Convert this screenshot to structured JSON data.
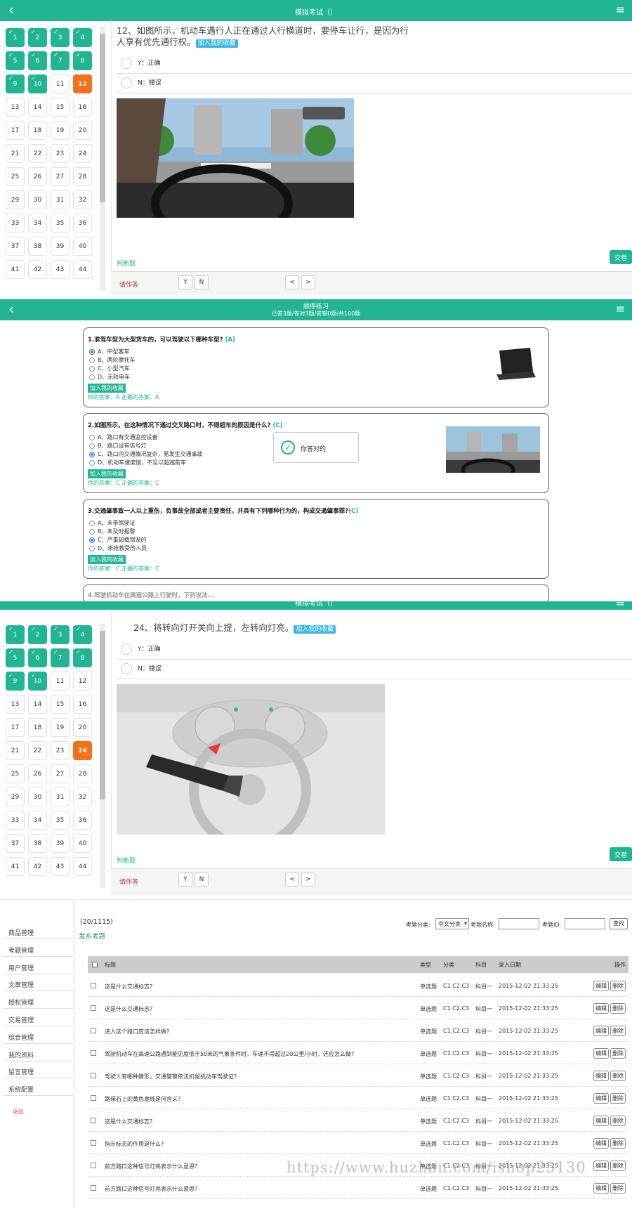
{
  "exam1": {
    "title": "模拟考试（）",
    "cells": [
      {
        "n": "1",
        "s": "ok"
      },
      {
        "n": "2",
        "s": "ok"
      },
      {
        "n": "3",
        "s": "ok"
      },
      {
        "n": "4",
        "s": "ok"
      },
      {
        "n": "5",
        "s": "ok"
      },
      {
        "n": "6",
        "s": "ok"
      },
      {
        "n": "7",
        "s": "ok"
      },
      {
        "n": "8",
        "s": "ok"
      },
      {
        "n": "9",
        "s": "ok"
      },
      {
        "n": "10",
        "s": "ok"
      },
      {
        "n": "11",
        "s": ""
      },
      {
        "n": "12",
        "s": "cur"
      },
      {
        "n": "13",
        "s": ""
      },
      {
        "n": "14",
        "s": ""
      },
      {
        "n": "15",
        "s": ""
      },
      {
        "n": "16",
        "s": ""
      },
      {
        "n": "17",
        "s": ""
      },
      {
        "n": "18",
        "s": ""
      },
      {
        "n": "19",
        "s": ""
      },
      {
        "n": "20",
        "s": ""
      },
      {
        "n": "21",
        "s": ""
      },
      {
        "n": "22",
        "s": ""
      },
      {
        "n": "23",
        "s": ""
      },
      {
        "n": "24",
        "s": ""
      },
      {
        "n": "25",
        "s": ""
      },
      {
        "n": "26",
        "s": ""
      },
      {
        "n": "27",
        "s": ""
      },
      {
        "n": "28",
        "s": ""
      },
      {
        "n": "29",
        "s": ""
      },
      {
        "n": "30",
        "s": ""
      },
      {
        "n": "31",
        "s": ""
      },
      {
        "n": "32",
        "s": ""
      },
      {
        "n": "33",
        "s": ""
      },
      {
        "n": "34",
        "s": ""
      },
      {
        "n": "35",
        "s": ""
      },
      {
        "n": "36",
        "s": ""
      },
      {
        "n": "37",
        "s": ""
      },
      {
        "n": "38",
        "s": ""
      },
      {
        "n": "39",
        "s": ""
      },
      {
        "n": "40",
        "s": ""
      },
      {
        "n": "41",
        "s": ""
      },
      {
        "n": "42",
        "s": ""
      },
      {
        "n": "43",
        "s": ""
      },
      {
        "n": "44",
        "s": ""
      }
    ],
    "question_line1": "12、如图所示，机动车遇行人正在通过人行横道时，要停车让行，是因为行",
    "question_line2": "人享有优先通行权。",
    "fav": "加入我的收藏",
    "opt_y": "Y：正确",
    "opt_n": "N：错误",
    "type_label": "判断题",
    "submit": "交卷",
    "status": "请作答",
    "btn_y": "Y",
    "btn_n": "N",
    "prev": "<",
    "next": ">"
  },
  "practice": {
    "title": "顺序练习",
    "subtitle": "已答3题/答对3题/答错0题/共100题",
    "cards": [
      {
        "q": "1.准驾车型为大型货车的，可以驾驶以下哪种车型?",
        "ans": "(A)",
        "opts": [
          "A、中型客车",
          "B、两轮摩托车",
          "C、小型汽车",
          "D、无轨电车"
        ],
        "sel": 0,
        "fav": "加入我的收藏",
        "res": "你的答案：A   正确的答案：A"
      },
      {
        "q": "2.如图所示，在这种情况下通过交叉路口时，不得超车的原因是什么?",
        "ans": "(C)",
        "opts": [
          "A、路口有交通监控设备",
          "B、路口设有信号灯",
          "C、路口内交通情况复杂，易发生交通事故",
          "D、机动车速度慢，不足以超越前车"
        ],
        "sel": 2,
        "fav": "加入我的收藏",
        "res": "你的答案：C   正确的答案：C"
      },
      {
        "q": "3.交通肇事致一人以上重伤，负事故全部或者主要责任，并具有下列哪种行为的，构成交通肇事罪?",
        "ans": "(C)",
        "opts": [
          "A、未带驾驶证",
          "B、未及时报警",
          "C、严重超载驾驶的",
          "D、未抢救受伤人员"
        ],
        "sel": 2,
        "fav": "加入我的收藏",
        "res": "你的答案：C   正确的答案：C"
      }
    ],
    "toast": "你答对的",
    "partial_q4": "4.驾驶机动车在高速公路上行驶时，下列说法..."
  },
  "exam2": {
    "title": "模拟考试（）",
    "question": "24、将转向灯开关向上提，左转向灯亮。",
    "fav": "加入我的收藏",
    "opt_y": "Y：正确",
    "opt_n": "N：错误",
    "type_label": "判断题",
    "submit": "交卷",
    "status": "请作答",
    "btn_y": "Y",
    "btn_n": "N",
    "prev": "<",
    "next": ">"
  },
  "admin": {
    "menu": [
      "商品管理",
      "考题管理",
      "用户管理",
      "文章管理",
      "授权管理",
      "交易管理",
      "综合管理",
      "我的资料",
      "留言管理",
      "系统配置"
    ],
    "logout": "退出",
    "count": "(20/1115)",
    "publish": "发布考题",
    "filter_label1": "考题分类:",
    "filter_select": "中文分类",
    "filter_label2": "考题名称:",
    "filter_label3": "考题ID:",
    "search_btn": "查找",
    "headers": {
      "title": "标题",
      "type": "类型",
      "cat": "分类",
      "subj": "科目",
      "date": "录入日期",
      "ops": "操作"
    },
    "rows": [
      {
        "t": "这是什么交通标志?",
        "type": "单选题",
        "cat": "C1.C2.C3",
        "subj": "科目一",
        "date": "2015-12-02 21:33:25"
      },
      {
        "t": "这是什么交通标志?",
        "type": "单选题",
        "cat": "C1.C2.C3",
        "subj": "科目一",
        "date": "2015-12-02 21:33:25"
      },
      {
        "t": "进入这个路口应该怎样做?",
        "type": "单选题",
        "cat": "C1.C2.C3",
        "subj": "科目一",
        "date": "2015-12-02 21:33:25"
      },
      {
        "t": "驾驶机动车在高速公路遇到能见度低于50米的气象条件时，车速不得超过20公里/小时，还应怎么做?",
        "type": "单选题",
        "cat": "C1.C2.C3",
        "subj": "科目一",
        "date": "2015-12-02 21:33:25"
      },
      {
        "t": "驾驶人有哪种情形，交通警察依法扣留机动车驾驶证?",
        "type": "单选题",
        "cat": "C1.C2.C3",
        "subj": "科目一",
        "date": "2015-12-02 21:33:25"
      },
      {
        "t": "路缘石上的黄色虚线是何含义?",
        "type": "单选题",
        "cat": "C1.C2.C3",
        "subj": "科目一",
        "date": "2015-12-02 21:33:25"
      },
      {
        "t": "这是什么交通标志?",
        "type": "单选题",
        "cat": "C1.C2.C3",
        "subj": "科目一",
        "date": "2015-12-02 21:33:25"
      },
      {
        "t": "指示标志的作用是什么?",
        "type": "单选题",
        "cat": "C1.C2.C3",
        "subj": "科目一",
        "date": "2015-12-02 21:33:25"
      },
      {
        "t": "前方路口这种信号灯亮表示什么意思?",
        "type": "单选题",
        "cat": "C1.C2.C3",
        "subj": "科目一",
        "date": "2015-12-02 21:33:25"
      },
      {
        "t": "前方路口这种信号灯亮表示什么意思?",
        "type": "单选题",
        "cat": "C1.C2.C3",
        "subj": "科目一",
        "date": "2015-12-02 21:33:25"
      }
    ],
    "edit": "编辑",
    "del": "删除"
  },
  "watermark": "https://www.huzhan.com/ishop25130"
}
